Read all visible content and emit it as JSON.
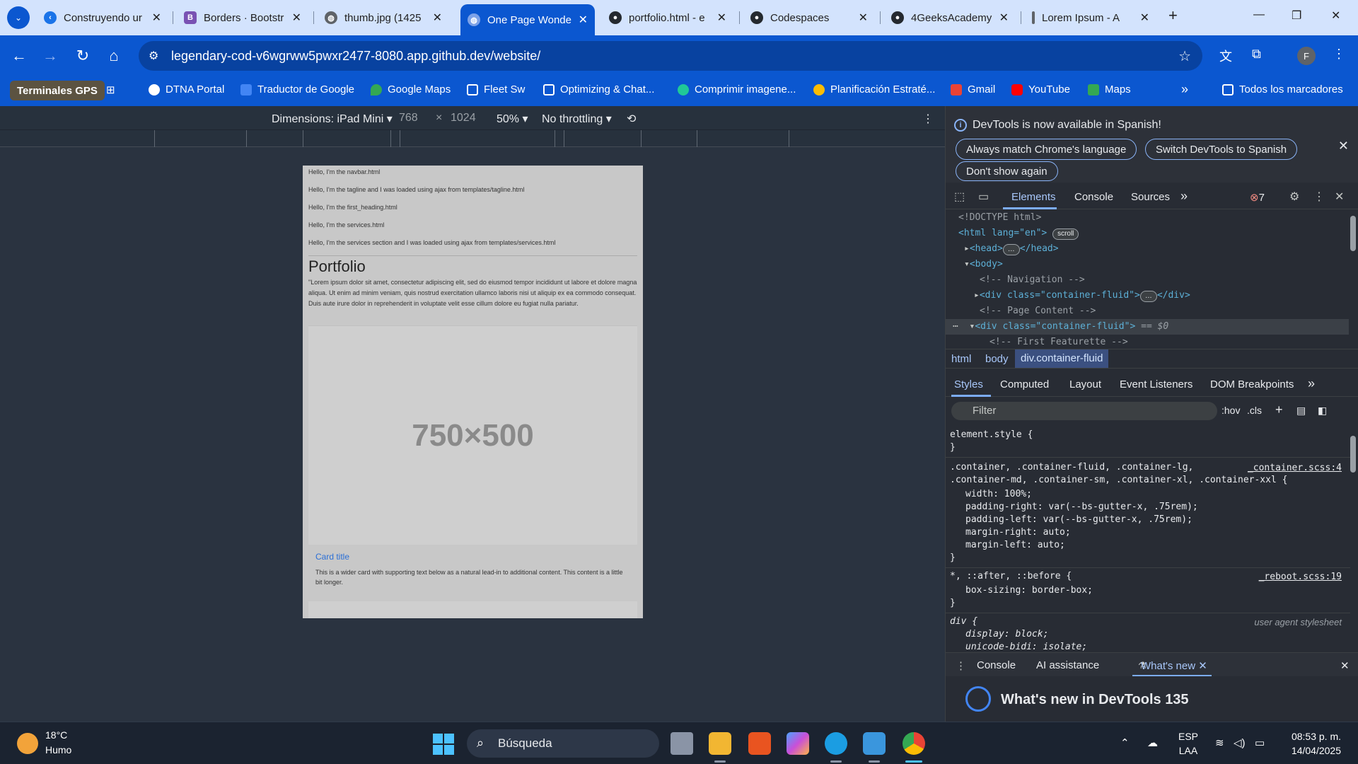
{
  "browser": {
    "tabs": [
      {
        "title": "Construyendo ur",
        "fav_color": "#1a73e8"
      },
      {
        "title": "Borders · Bootstr",
        "fav_color": "#7952b3",
        "fav_letter": "B"
      },
      {
        "title": "thumb.jpg (1425",
        "fav_color": "#5f6368"
      },
      {
        "title": "One Page Wonde",
        "fav_color": "#5f6368",
        "active": true
      },
      {
        "title": "portfolio.html - e",
        "fav_color": "#24292f"
      },
      {
        "title": "Codespaces",
        "fav_color": "#24292f"
      },
      {
        "title": "4GeeksAcademy",
        "fav_color": "#24292f"
      },
      {
        "title": "Lorem Ipsum - A",
        "fav_color": "#5f6368"
      }
    ],
    "url": "legendary-cod-v6wgrww5pwxr2477-8080.app.github.dev/website/",
    "profile_letter": "F",
    "bookmarks": [
      {
        "label": "Terminales GPS"
      },
      {
        "label": "DTNA Portal",
        "color": "#ffffff"
      },
      {
        "label": "Traductor de Google",
        "color": "#4285f4"
      },
      {
        "label": "Google Maps",
        "color": "#34a853"
      },
      {
        "label": "Fleet Sw",
        "color": "#ffffff"
      },
      {
        "label": "Optimizing & Chat...",
        "color": "#ffffff"
      },
      {
        "label": "Comprimir imagene...",
        "color": "#20c997"
      },
      {
        "label": "Planificación Estraté...",
        "color": "#fbbc04"
      },
      {
        "label": "Gmail",
        "color": "#ea4335"
      },
      {
        "label": "YouTube",
        "color": "#ff0000"
      },
      {
        "label": "Maps",
        "color": "#34a853"
      }
    ],
    "all_bookmarks": "Todos los marcadores"
  },
  "device_toolbar": {
    "dimensions_label": "Dimensions: iPad Mini",
    "width": "768",
    "times": "×",
    "height": "1024",
    "zoom": "50%",
    "throttling": "No throttling"
  },
  "page": {
    "lines": [
      "Hello, I'm the navbar.html",
      "Hello, I'm the tagline and I was loaded using ajax from templates/tagline.html",
      "Hello, I'm the first_heading.html",
      "Hello, I'm the services.html",
      "Hello, I'm the services section and I was loaded using ajax from templates/services.html"
    ],
    "heading": "Portfolio",
    "lorem": "\"Lorem ipsum dolor sit amet, consectetur adipiscing elit, sed do eiusmod tempor incididunt ut labore et dolore magna aliqua. Ut enim ad minim veniam, quis nostrud exercitation ullamco laboris nisi ut aliquip ex ea commodo consequat. Duis aute irure dolor in reprehenderit in voluptate velit esse cillum dolore eu fugiat nulla pariatur.",
    "placeholder": "750×500",
    "card_title": "Card title",
    "card_text": "This is a wider card with supporting text below as a natural lead-in to additional content. This content is a little bit longer."
  },
  "devtools": {
    "banner": "DevTools is now available in Spanish!",
    "btn_match": "Always match Chrome's language",
    "btn_switch": "Switch DevTools to Spanish",
    "btn_dont": "Don't show again",
    "tabs": [
      "Elements",
      "Console",
      "Sources"
    ],
    "error_count": "7",
    "dom": {
      "doctype": "<!DOCTYPE html>",
      "html_open": "<html lang=\"en\">",
      "scroll": "scroll",
      "head": "<head>",
      "head_close": "</head>",
      "body": "<body>",
      "c_nav": "<!-- Navigation -->",
      "div_fluid": "<div class=\"container-fluid\">",
      "div_close": "</div>",
      "c_page": "<!-- Page Content -->",
      "div_sel": "<div class=\"container-fluid\">",
      "sel_eq": "== $0",
      "c_feat": "<!-- First Featurette -->"
    },
    "breadcrumbs": [
      "html",
      "body",
      "div.container-fluid"
    ],
    "style_tabs": [
      "Styles",
      "Computed",
      "Layout",
      "Event Listeners",
      "DOM Breakpoints"
    ],
    "filter": "Filter",
    "hov": ":hov",
    "cls": ".cls",
    "styles": {
      "element_style": "element.style {",
      "close": "}",
      "container_sel_1": ".container, .container-fluid, .container-lg,",
      "container_sel_2": ".container-md, .container-sm, .container-xl, .container-xxl {",
      "container_src": "_container.scss:4",
      "p_width": "width: 100%;",
      "p_pr": "padding-right: var(--bs-gutter-x, .75rem);",
      "p_pl": "padding-left: var(--bs-gutter-x, .75rem);",
      "p_mr": "margin-right: auto;",
      "p_ml": "margin-left: auto;",
      "reboot_sel": "*, ::after, ::before {",
      "reboot_src": "_reboot.scss:19",
      "p_bs": "box-sizing: border-box;",
      "div_sel": "div {",
      "ua": "user agent stylesheet",
      "p_display": "display: block;",
      "p_ub": "unicode-bidi: isolate;"
    },
    "drawer_tabs": [
      "Console",
      "AI assistance",
      "What's new"
    ],
    "whats_new": "What's new in DevTools 135"
  },
  "taskbar": {
    "temp": "18°C",
    "weather": "Humo",
    "search": "Búsqueda",
    "lang1": "ESP",
    "lang2": "LAA",
    "time": "08:53 p. m.",
    "date": "14/04/2025"
  }
}
